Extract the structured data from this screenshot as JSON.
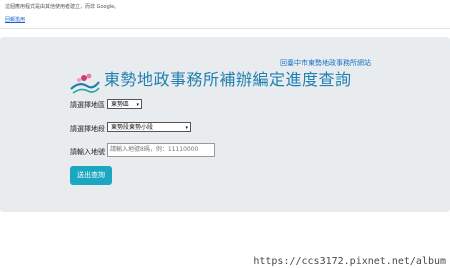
{
  "google_bar": {
    "note": "這個應用程式是由其他使用者建立，而非 Google。",
    "report_link": "回報濫用"
  },
  "header": {
    "back_link": "回臺中市東勢地政事務所網站",
    "title": "東勢地政事務所補辦編定進度查詢"
  },
  "form": {
    "district_label": "請選擇地區",
    "district_value": "東勢區",
    "section_label": "請選擇地段",
    "section_value": "東勢段東勢小段",
    "landno_label": "請輸入地號",
    "landno_placeholder": "請輸入地號8碼，例：11110000",
    "submit_label": "送出查詢"
  },
  "watermark": "https://ccs3172.pixnet.net/album",
  "colors": {
    "title": "#1f7fb0",
    "button": "#1ba6c1",
    "panel": "#e9ecef"
  }
}
